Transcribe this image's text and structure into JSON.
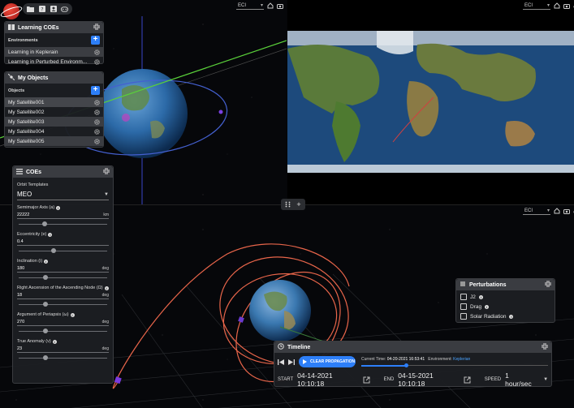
{
  "views": {
    "frame_label": "ECI"
  },
  "learning_panel": {
    "title": "Learning COEs",
    "section": "Environments",
    "items": [
      {
        "label": "Learning in Keplerain"
      },
      {
        "label": "Learning in Perturbed Environm..."
      }
    ]
  },
  "objects_panel": {
    "title": "My Objects",
    "section": "Objects",
    "items": [
      {
        "label": "My Satellite001"
      },
      {
        "label": "My Satellite002"
      },
      {
        "label": "My Satellite003"
      },
      {
        "label": "My Satellite004"
      },
      {
        "label": "My Satellite005"
      }
    ]
  },
  "coes_panel": {
    "title": "COEs",
    "orbit_templates_label": "Orbit Templates",
    "orbit_template_value": "MEO",
    "fields": [
      {
        "label": "Semimajor Axis (a)",
        "value": "22222",
        "unit": "km",
        "position": 0.3
      },
      {
        "label": "Eccentricity (e)",
        "value": "0.4",
        "unit": "",
        "position": 0.4
      },
      {
        "label": "Inclination (i)",
        "value": "180",
        "unit": "deg",
        "position": 0.31
      },
      {
        "label": "Right Ascension of the Ascending Node (Ω)",
        "value": "18",
        "unit": "deg",
        "position": 0.31
      },
      {
        "label": "Argument of Periapsis (ω)",
        "value": "270",
        "unit": "deg",
        "position": 0.31
      },
      {
        "label": "True Anomaly (ν)",
        "value": "23",
        "unit": "deg",
        "position": 0.31
      }
    ]
  },
  "perturbations_panel": {
    "title": "Perturbations",
    "items": [
      {
        "label": "J2",
        "checked": false
      },
      {
        "label": "Drag",
        "checked": false
      },
      {
        "label": "Solar Radiation",
        "checked": false
      }
    ]
  },
  "timeline": {
    "title": "Timeline",
    "clear_label": "CLEAR PROPAGATION",
    "current_time_label": "Current Time:",
    "current_time": "04-20-2021 16:53:41",
    "environment_label": "Environment:",
    "environment": "Keplerian",
    "progress": 0.24,
    "start_label": "START",
    "start_value": "04-14-2021 10:10:18",
    "end_label": "END",
    "end_value": "04-15-2021 10:10:18",
    "speed_label": "SPEED",
    "speed_value": "1 hour/sec"
  },
  "colors": {
    "accent": "#2d7ff9",
    "panel": "#1c1e22",
    "orbit": "#e8654a"
  }
}
